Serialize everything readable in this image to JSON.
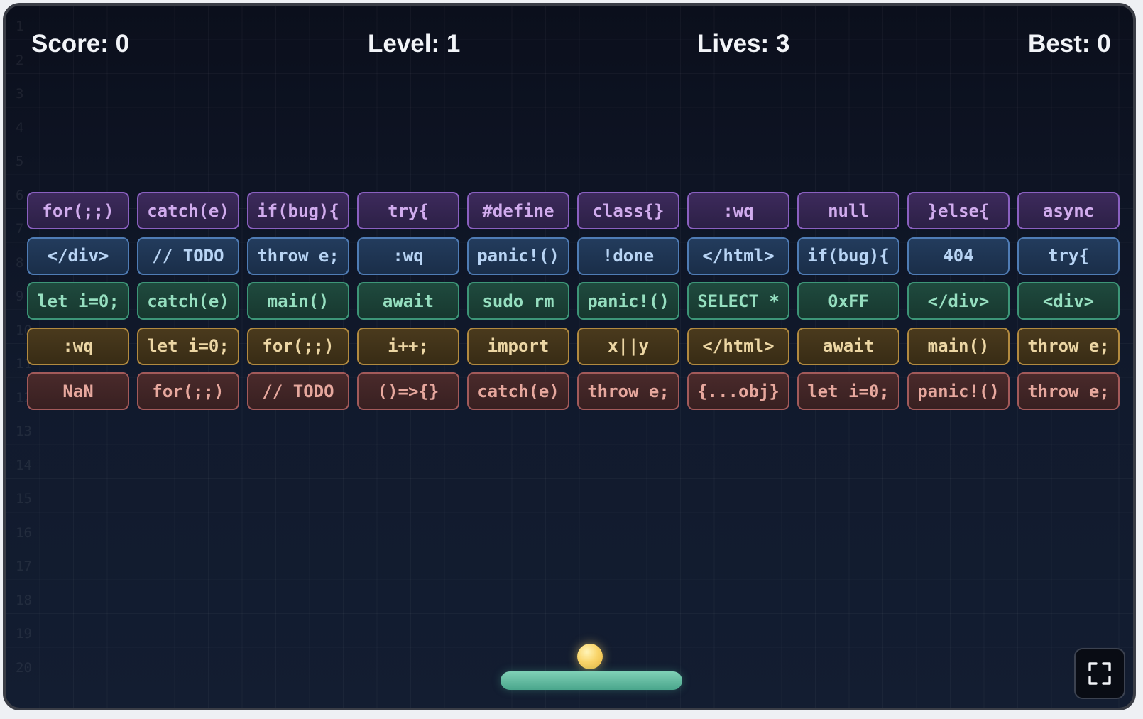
{
  "hud": {
    "score": "Score: 0",
    "level": "Level: 1",
    "lives": "Lives: 3",
    "best": "Best: 0"
  },
  "line_numbers": [
    "1",
    "2",
    "3",
    "4",
    "5",
    "6",
    "7",
    "8",
    "9",
    "10",
    "11",
    "12",
    "13",
    "14",
    "15",
    "16",
    "17",
    "18",
    "19",
    "20"
  ],
  "bricks": [
    [
      "for(;;)",
      "catch(e)",
      "if(bug){",
      "try{",
      "#define",
      "class{}",
      ":wq",
      "null",
      "}else{",
      "async"
    ],
    [
      "</div>",
      "// TODO",
      "throw e;",
      ":wq",
      "panic!()",
      "!done",
      "</html>",
      "if(bug){",
      "404",
      "try{"
    ],
    [
      "let i=0;",
      "catch(e)",
      "main()",
      "await",
      "sudo rm",
      "panic!()",
      "SELECT *",
      "0xFF",
      "</div>",
      "<div>"
    ],
    [
      ":wq",
      "let i=0;",
      "for(;;)",
      "i++;",
      "import",
      "x||y",
      "</html>",
      "await",
      "main()",
      "throw e;"
    ],
    [
      "NaN",
      "for(;;)",
      "// TODO",
      "()=>{}",
      "catch(e)",
      "throw e;",
      "{...obj}",
      "let i=0;",
      "panic!()",
      "throw e;"
    ]
  ],
  "colors": {
    "background": "#0d1220",
    "row_colors": [
      "#8a60c0",
      "#4f7cb5",
      "#3d9678",
      "#b28a3f",
      "#a35a5a"
    ],
    "ball": "#f9d56b",
    "paddle": "#5fbfa0"
  },
  "icons": {
    "fullscreen": "fullscreen-icon"
  }
}
